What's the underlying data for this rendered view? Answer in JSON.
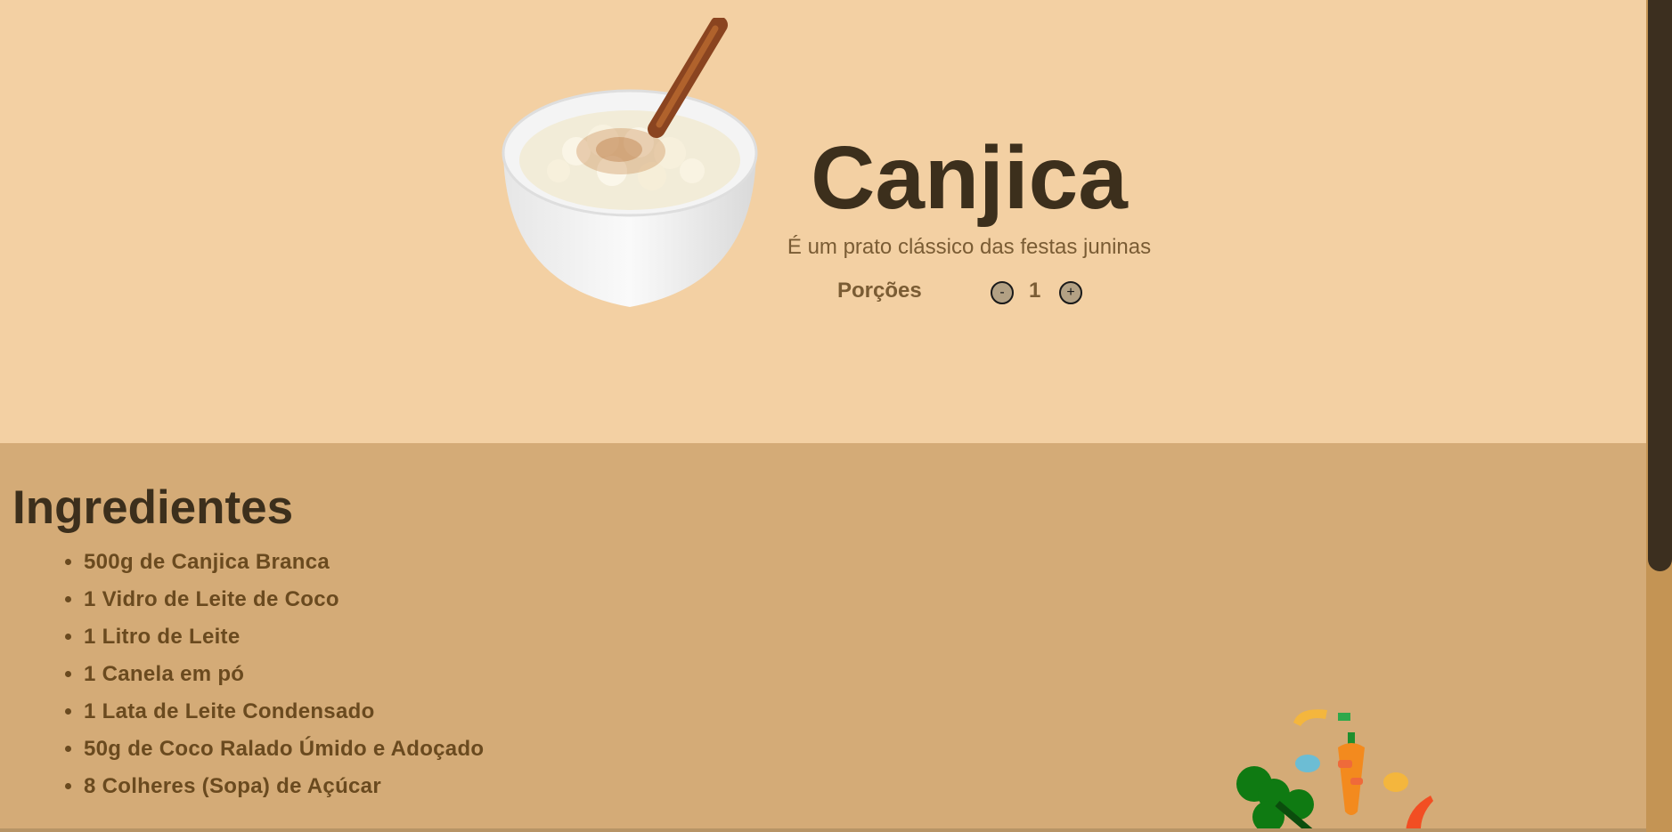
{
  "hero": {
    "title": "Canjica",
    "subtitle": "É um prato clássico das festas juninas",
    "servings_label": "Porções",
    "servings_value": "1",
    "minus_label": "-",
    "plus_label": "+",
    "image_icon": "canjica-bowl-image"
  },
  "ingredients": {
    "title": "Ingredientes",
    "items": [
      "500g de Canjica Branca",
      "1 Vidro de Leite de Coco",
      "1 Litro de Leite",
      "1 Canela em pó",
      "1 Lata de Leite Condensado",
      "50g de Coco Ralado Úmido e Adoçado",
      "8 Colheres (Sopa) de Açúcar"
    ]
  },
  "decoration": {
    "icon": "vegetables-illustration"
  },
  "colors": {
    "hero_bg": "#f3d0a3",
    "section_bg": "#d4ab77",
    "title_text": "#3c2f1c",
    "accent_text": "#7a5c34",
    "scroll_thumb": "#3c2f1f"
  }
}
